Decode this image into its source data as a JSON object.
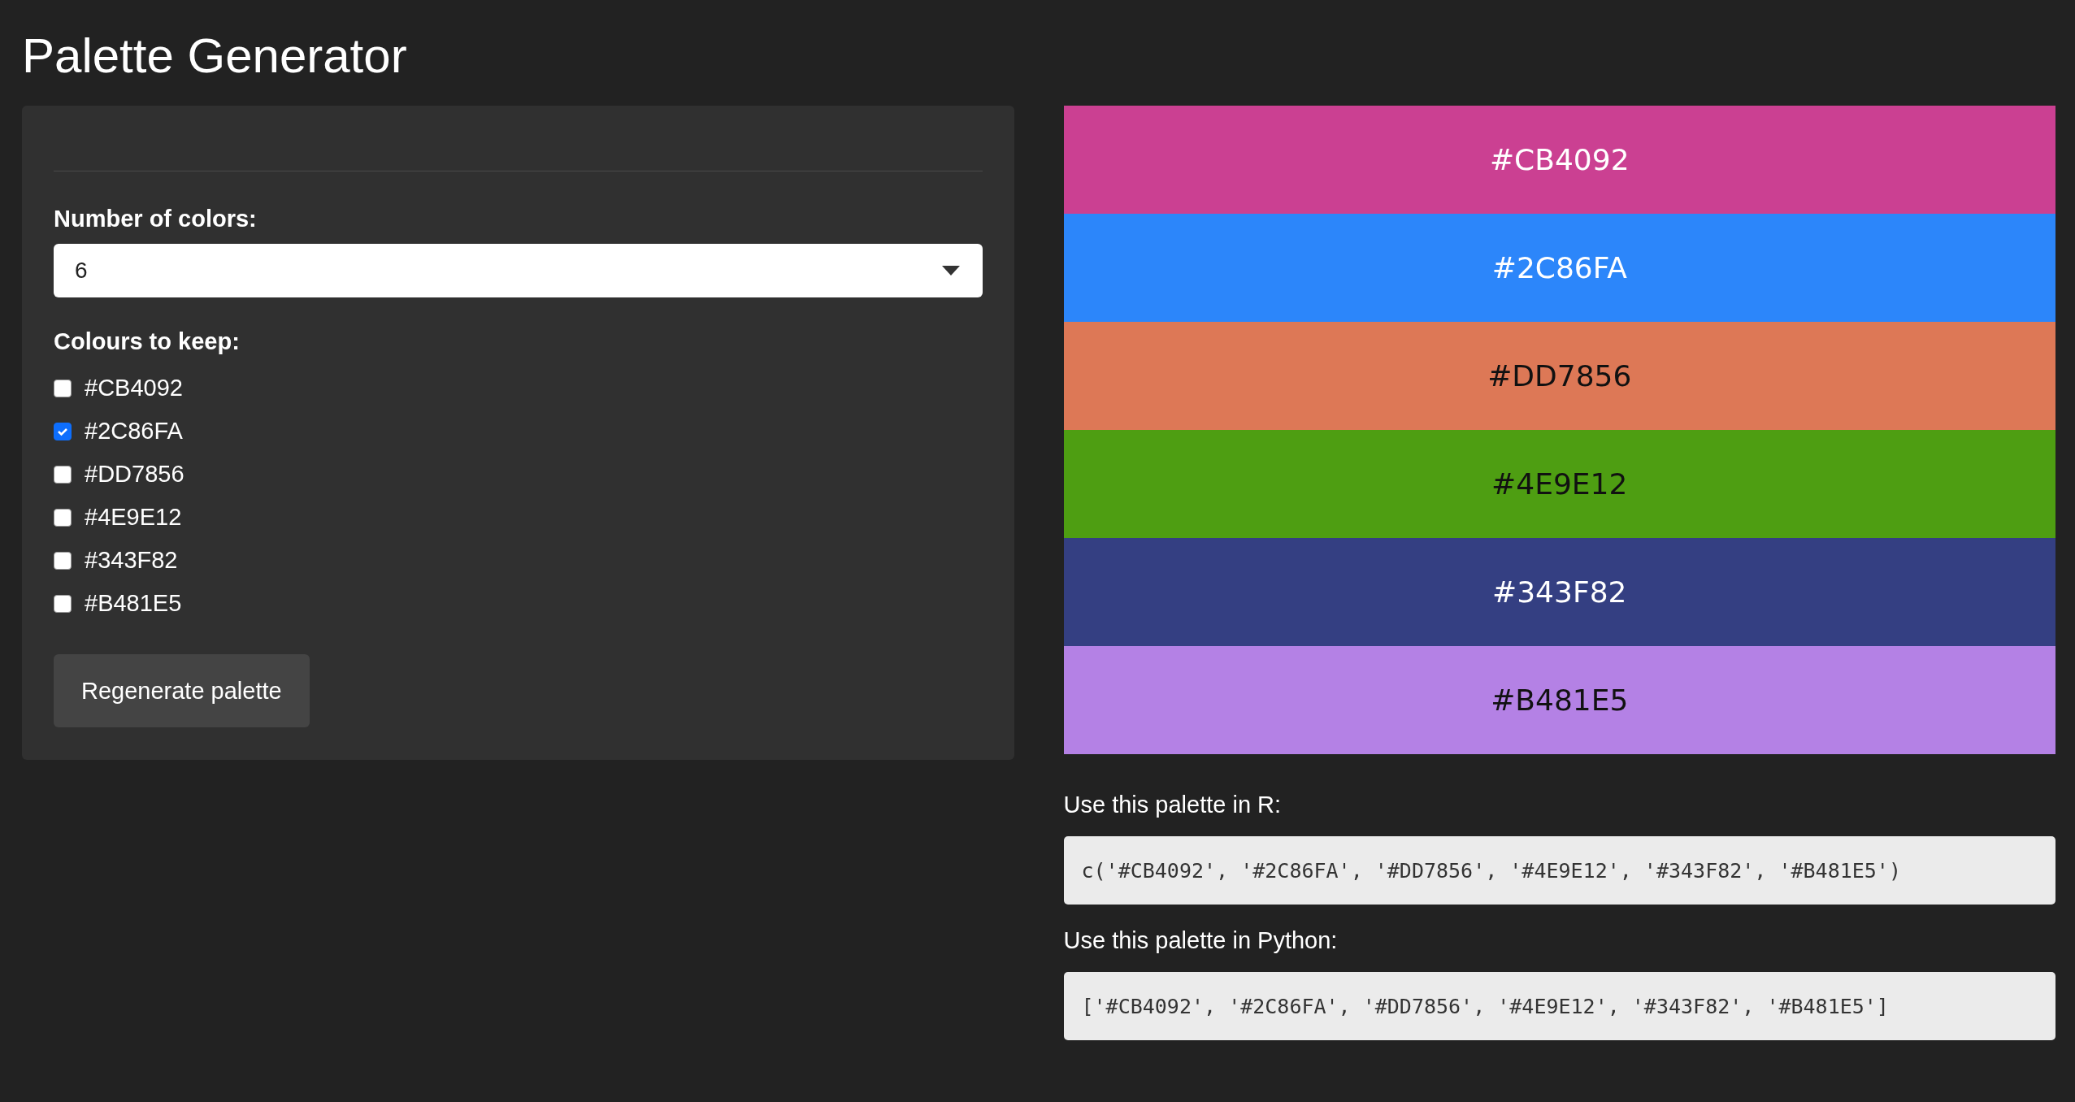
{
  "title": "Palette Generator",
  "controls": {
    "number_label": "Number of colors:",
    "number_select": {
      "value": "6"
    },
    "keep_label": "Colours to keep:",
    "keep_options": [
      {
        "label": "#CB4092",
        "checked": false
      },
      {
        "label": "#2C86FA",
        "checked": true
      },
      {
        "label": "#DD7856",
        "checked": false
      },
      {
        "label": "#4E9E12",
        "checked": false
      },
      {
        "label": "#343F82",
        "checked": false
      },
      {
        "label": "#B481E5",
        "checked": false
      }
    ],
    "button": "Regenerate palette"
  },
  "swatches": [
    {
      "label": "#CB4092",
      "color": "#cb4092",
      "dark_text": false
    },
    {
      "label": "#2C86FA",
      "color": "#2c86fa",
      "dark_text": false
    },
    {
      "label": "#DD7856",
      "color": "#dd7856",
      "dark_text": true
    },
    {
      "label": "#4E9E12",
      "color": "#4e9e12",
      "dark_text": true
    },
    {
      "label": "#343F82",
      "color": "#343f82",
      "dark_text": false
    },
    {
      "label": "#B481E5",
      "color": "#b481e5",
      "dark_text": true
    }
  ],
  "r_label": "Use this palette in R:",
  "r_code": "c('#CB4092', '#2C86FA', '#DD7856', '#4E9E12', '#343F82', '#B481E5')",
  "python_label": "Use this palette in Python:",
  "python_code": "['#CB4092', '#2C86FA', '#DD7856', '#4E9E12', '#343F82', '#B481E5']"
}
